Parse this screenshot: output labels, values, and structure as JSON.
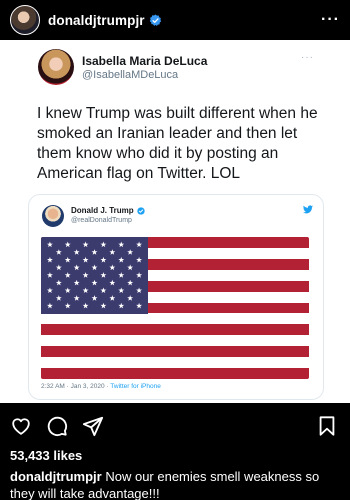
{
  "instagram": {
    "username": "donaldjtrumpjr",
    "verified": true,
    "more_icon": "ellipsis-icon",
    "likes": "53,433 likes",
    "caption": {
      "username": "donaldjtrumpjr",
      "text": "Now our enemies smell weakness so they will take advantage!!!"
    },
    "actions": [
      "heart-icon",
      "comment-icon",
      "share-icon",
      "bookmark-icon"
    ]
  },
  "tweet_outer": {
    "name": "Isabella Maria DeLuca",
    "handle": "@IsabellaMDeLuca",
    "more": "···",
    "text": "I knew Trump was built different when he smoked an Iranian leader and then let them know who did it by posting an American flag on Twitter. LOL"
  },
  "tweet_embedded": {
    "name": "Donald J. Trump",
    "handle": "@realDonaldTrump",
    "verified": true,
    "timestamp": "2:32 AM · Jan 3, 2020 · ",
    "source": "Twitter for iPhone",
    "image": "american-flag"
  },
  "colors": {
    "twitter_blue": "#1da1f2",
    "flag_red": "#b22234",
    "flag_blue": "#3c3b6e",
    "instagram_verified": "#3897f0"
  }
}
